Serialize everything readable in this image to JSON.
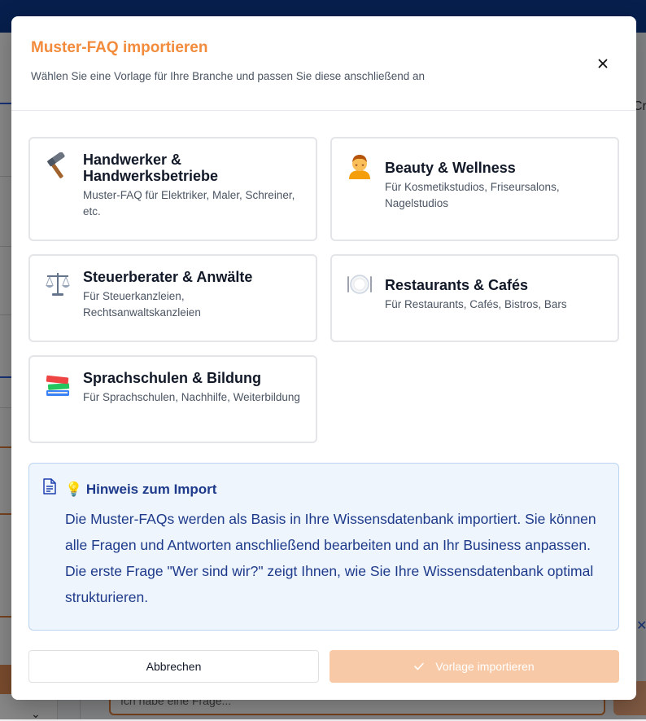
{
  "background": {
    "truncated_tab_text": "Cr",
    "chat_input_placeholder": "Ich habe eine Frage..."
  },
  "modal": {
    "title": "Muster-FAQ importieren",
    "subtitle": "Wählen Sie eine Vorlage für Ihre Branche und passen Sie diese anschließend an",
    "close_icon": "close-icon",
    "templates": [
      {
        "icon": "hammer-icon",
        "emoji": "🔨",
        "title": "Handwerker & Handwerksbetriebe",
        "description": "Muster-FAQ für Elektriker, Maler, Schreiner, etc."
      },
      {
        "icon": "massage-icon",
        "emoji": "💆",
        "title": "Beauty & Wellness",
        "description": "Für Kosmetikstudios, Friseursalons, Nagelstudios"
      },
      {
        "icon": "scales-icon",
        "emoji": "⚖️",
        "title": "Steuerberater & Anwälte",
        "description": "Für Steuerkanzleien, Rechtsanwaltskanzleien"
      },
      {
        "icon": "plate-cutlery-icon",
        "emoji": "🍽️",
        "title": "Restaurants & Cafés",
        "description": "Für Restaurants, Cafés, Bistros, Bars"
      },
      {
        "icon": "books-icon",
        "emoji": "📚",
        "title": "Sprachschulen & Bildung",
        "description": "Für Sprachschulen, Nachhilfe, Weiterbildung"
      }
    ],
    "hint": {
      "icon": "document-icon",
      "title": "💡 Hinweis zum Import",
      "text": "Die Muster-FAQs werden als Basis in Ihre Wissensdatenbank importiert. Sie können alle Fragen und Antworten anschließend bearbeiten und an Ihr Business anpassen. Die erste Frage \"Wer sind wir?\" zeigt Ihnen, wie Sie Ihre Wissensdatenbank optimal strukturieren."
    },
    "buttons": {
      "cancel": "Abbrechen",
      "import": "Vorlage importieren"
    },
    "colors": {
      "title_accent": "#f28c3c",
      "import_button_disabled": "#f8c9a6",
      "hint_background": "#eef5fd",
      "hint_text": "#1e3a8a"
    }
  }
}
